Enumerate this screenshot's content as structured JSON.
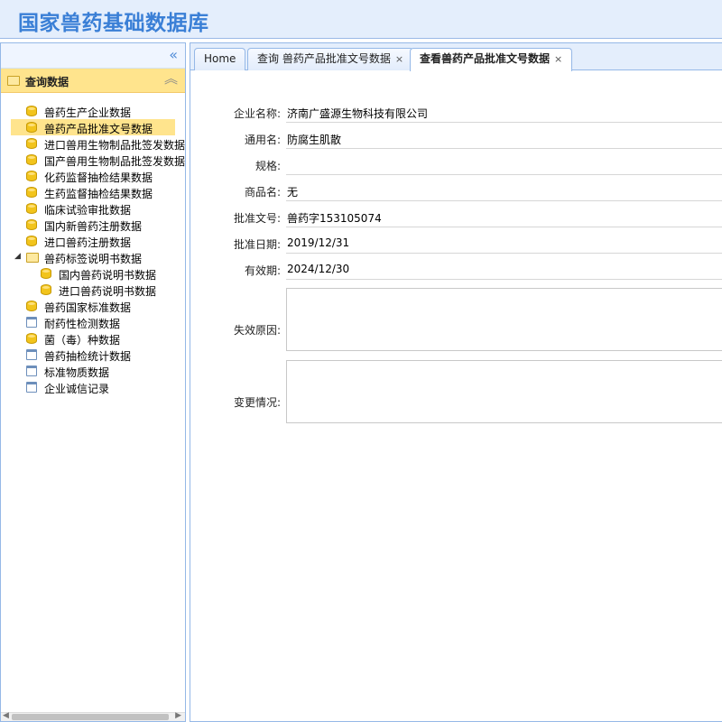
{
  "header": {
    "title": "国家兽药基础数据库"
  },
  "sidebar": {
    "collapse_icon": "double-chevron-left-icon",
    "section_title": "查询数据",
    "items": [
      {
        "label": "兽药生产企业数据",
        "icon": "database-icon",
        "selected": false
      },
      {
        "label": "兽药产品批准文号数据",
        "icon": "database-icon",
        "selected": true
      },
      {
        "label": "进口兽用生物制品批签发数据",
        "icon": "database-icon",
        "selected": false
      },
      {
        "label": "国产兽用生物制品批签发数据",
        "icon": "database-icon",
        "selected": false
      },
      {
        "label": "化药监督抽检结果数据",
        "icon": "database-icon",
        "selected": false
      },
      {
        "label": "生药监督抽检结果数据",
        "icon": "database-icon",
        "selected": false
      },
      {
        "label": "临床试验审批数据",
        "icon": "database-icon",
        "selected": false
      },
      {
        "label": "国内新兽药注册数据",
        "icon": "database-icon",
        "selected": false
      },
      {
        "label": "进口兽药注册数据",
        "icon": "database-icon",
        "selected": false
      },
      {
        "label": "兽药标签说明书数据",
        "icon": "folder-icon",
        "selected": false,
        "expanded": true
      },
      {
        "label": "国内兽药说明书数据",
        "icon": "database-icon",
        "selected": false,
        "child": true
      },
      {
        "label": "进口兽药说明书数据",
        "icon": "database-icon",
        "selected": false,
        "child": true
      },
      {
        "label": "兽药国家标准数据",
        "icon": "database-icon",
        "selected": false
      },
      {
        "label": "耐药性检测数据",
        "icon": "file-icon",
        "selected": false
      },
      {
        "label": "菌（毒）种数据",
        "icon": "database-icon",
        "selected": false
      },
      {
        "label": "兽药抽检统计数据",
        "icon": "file-icon",
        "selected": false
      },
      {
        "label": "标准物质数据",
        "icon": "file-icon",
        "selected": false
      },
      {
        "label": "企业诚信记录",
        "icon": "file-icon",
        "selected": false
      }
    ]
  },
  "tabs": [
    {
      "label": "Home",
      "closable": false,
      "active": false
    },
    {
      "label": "查询 兽药产品批准文号数据",
      "closable": true,
      "active": false
    },
    {
      "label": "查看兽药产品批准文号数据",
      "closable": true,
      "active": true
    }
  ],
  "tab_close_glyph": "×",
  "form": {
    "fields": [
      {
        "label": "企业名称:",
        "value": "济南广盛源生物科技有限公司"
      },
      {
        "label": "通用名:",
        "value": "防腐生肌散"
      },
      {
        "label": "规格:",
        "value": ""
      },
      {
        "label": "商品名:",
        "value": "无"
      },
      {
        "label": "批准文号:",
        "value": "兽药字153105074"
      },
      {
        "label": "批准日期:",
        "value": "2019/12/31"
      },
      {
        "label": "有效期:",
        "value": "2024/12/30"
      }
    ],
    "failure_reason_label": "失效原因:",
    "failure_reason_value": "",
    "change_info_label": "变更情况:",
    "change_info_value": ""
  },
  "colors": {
    "header_bg": "#e4eefc",
    "title": "#3a7fd6",
    "selected_bg": "#ffe48d",
    "border": "#95b8e7"
  }
}
